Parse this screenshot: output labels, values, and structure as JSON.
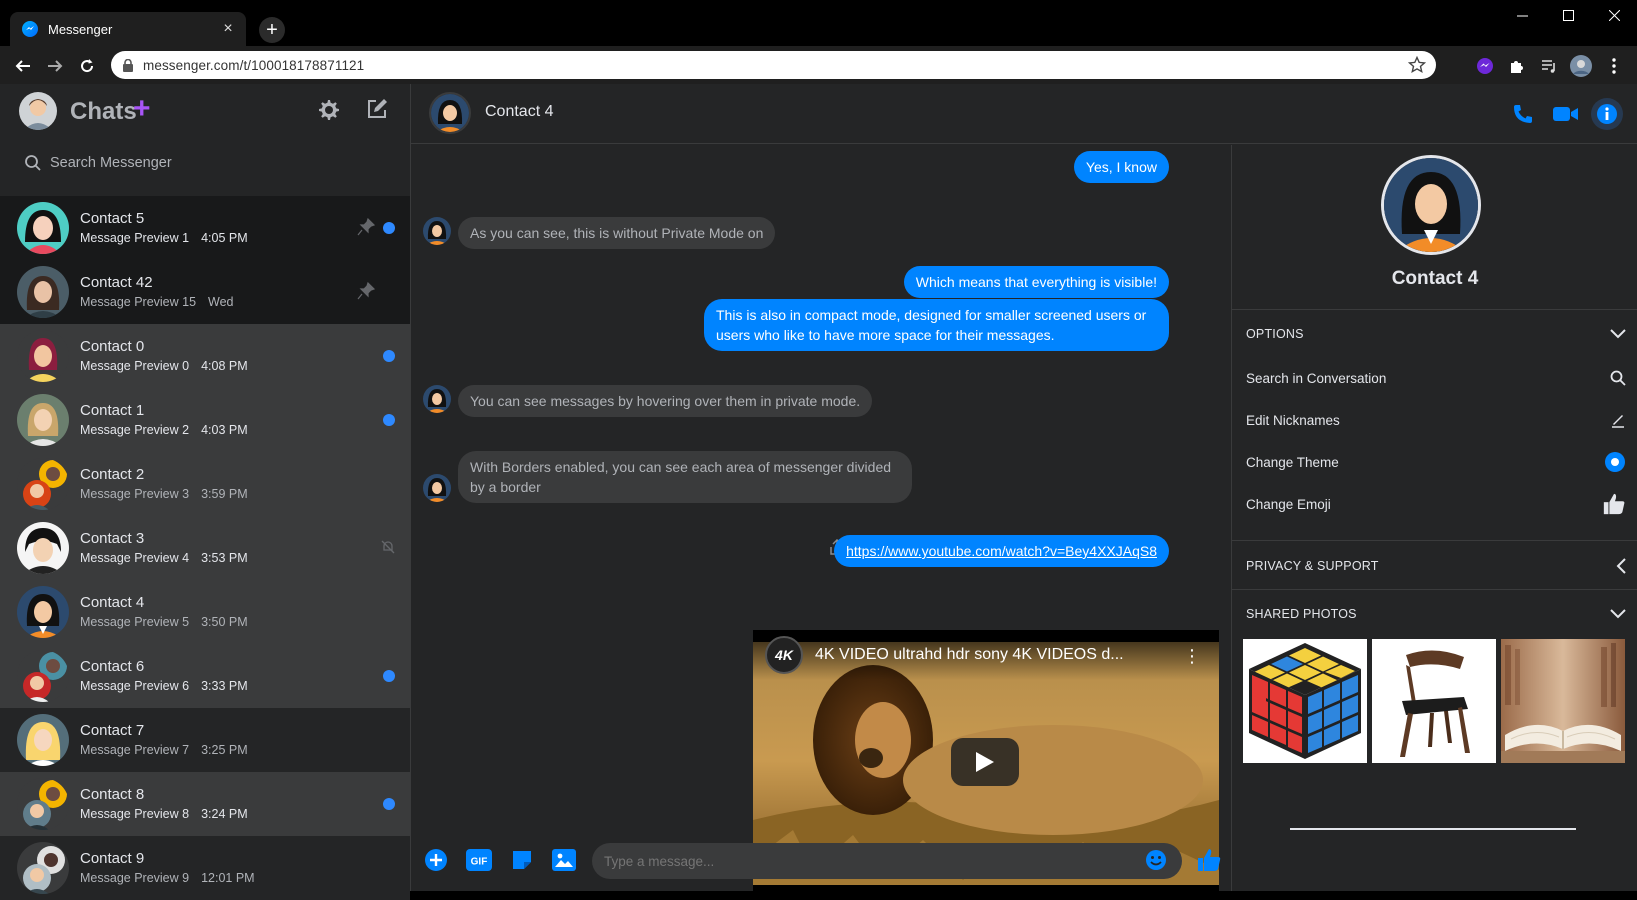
{
  "browser": {
    "tab_title": "Messenger",
    "url": "messenger.com/t/100018178871121"
  },
  "sidebar": {
    "title": "Chats",
    "search_placeholder": "Search Messenger",
    "contacts": [
      {
        "name": "Contact 5",
        "preview": "Message Preview 1",
        "time": "4:05 PM",
        "unread": true,
        "pinned": true
      },
      {
        "name": "Contact 42",
        "preview": "Message Preview 15",
        "time": "Wed",
        "unread": false,
        "pinned": true
      },
      {
        "name": "Contact 0",
        "preview": "Message Preview 0",
        "time": "4:08 PM",
        "unread": true
      },
      {
        "name": "Contact 1",
        "preview": "Message Preview 2",
        "time": "4:03 PM",
        "unread": true
      },
      {
        "name": "Contact 2",
        "preview": "Message Preview 3",
        "time": "3:59 PM",
        "unread": false
      },
      {
        "name": "Contact 3",
        "preview": "Message Preview 4",
        "time": "3:53 PM",
        "unread": true,
        "muted": true
      },
      {
        "name": "Contact 4",
        "preview": "Message Preview 5",
        "time": "3:50 PM",
        "unread": false
      },
      {
        "name": "Contact 6",
        "preview": "Message Preview 6",
        "time": "3:33 PM",
        "unread": true
      },
      {
        "name": "Contact 7",
        "preview": "Message Preview 7",
        "time": "3:25 PM",
        "unread": false
      },
      {
        "name": "Contact 8",
        "preview": "Message Preview 8",
        "time": "3:24 PM",
        "unread": true
      },
      {
        "name": "Contact 9",
        "preview": "Message Preview 9",
        "time": "12:01 PM",
        "unread": false
      }
    ]
  },
  "chat": {
    "contact_name": "Contact 4",
    "messages": [
      {
        "dir": "out",
        "text": "Yes, I know"
      },
      {
        "dir": "in",
        "text": "As you can see, this is without Private Mode on"
      },
      {
        "dir": "out",
        "text": "Which means that everything is visible!"
      },
      {
        "dir": "out",
        "text": "This is also in compact mode, designed for smaller screened users or users who like to have more space for their messages."
      },
      {
        "dir": "in",
        "text": "You can see messages by hovering over them in private mode."
      },
      {
        "dir": "in",
        "text": "With Borders enabled, you can see each area of messenger divided by a border"
      },
      {
        "dir": "out",
        "text": "https://www.youtube.com/watch?v=Bey4XXJAqS8"
      }
    ],
    "video": {
      "channel_badge": "4K",
      "title": "4K VIDEO ultrahd hdr sony 4K VIDEOS d..."
    },
    "composer_placeholder": "Type a message..."
  },
  "info_panel": {
    "name": "Contact 4",
    "options_label": "OPTIONS",
    "options": [
      {
        "label": "Search in Conversation",
        "icon": "search-icon"
      },
      {
        "label": "Edit Nicknames",
        "icon": "pencil-icon"
      },
      {
        "label": "Change Theme",
        "icon": "theme-dot-icon"
      },
      {
        "label": "Change Emoji",
        "icon": "thumbs-up-icon"
      }
    ],
    "privacy_label": "PRIVACY & SUPPORT",
    "photos_label": "SHARED PHOTOS"
  },
  "colors": {
    "accent": "#0084ff",
    "bg": "#242526",
    "bubble_in": "#3a3b3c",
    "purple_plus": "#a855f7"
  }
}
